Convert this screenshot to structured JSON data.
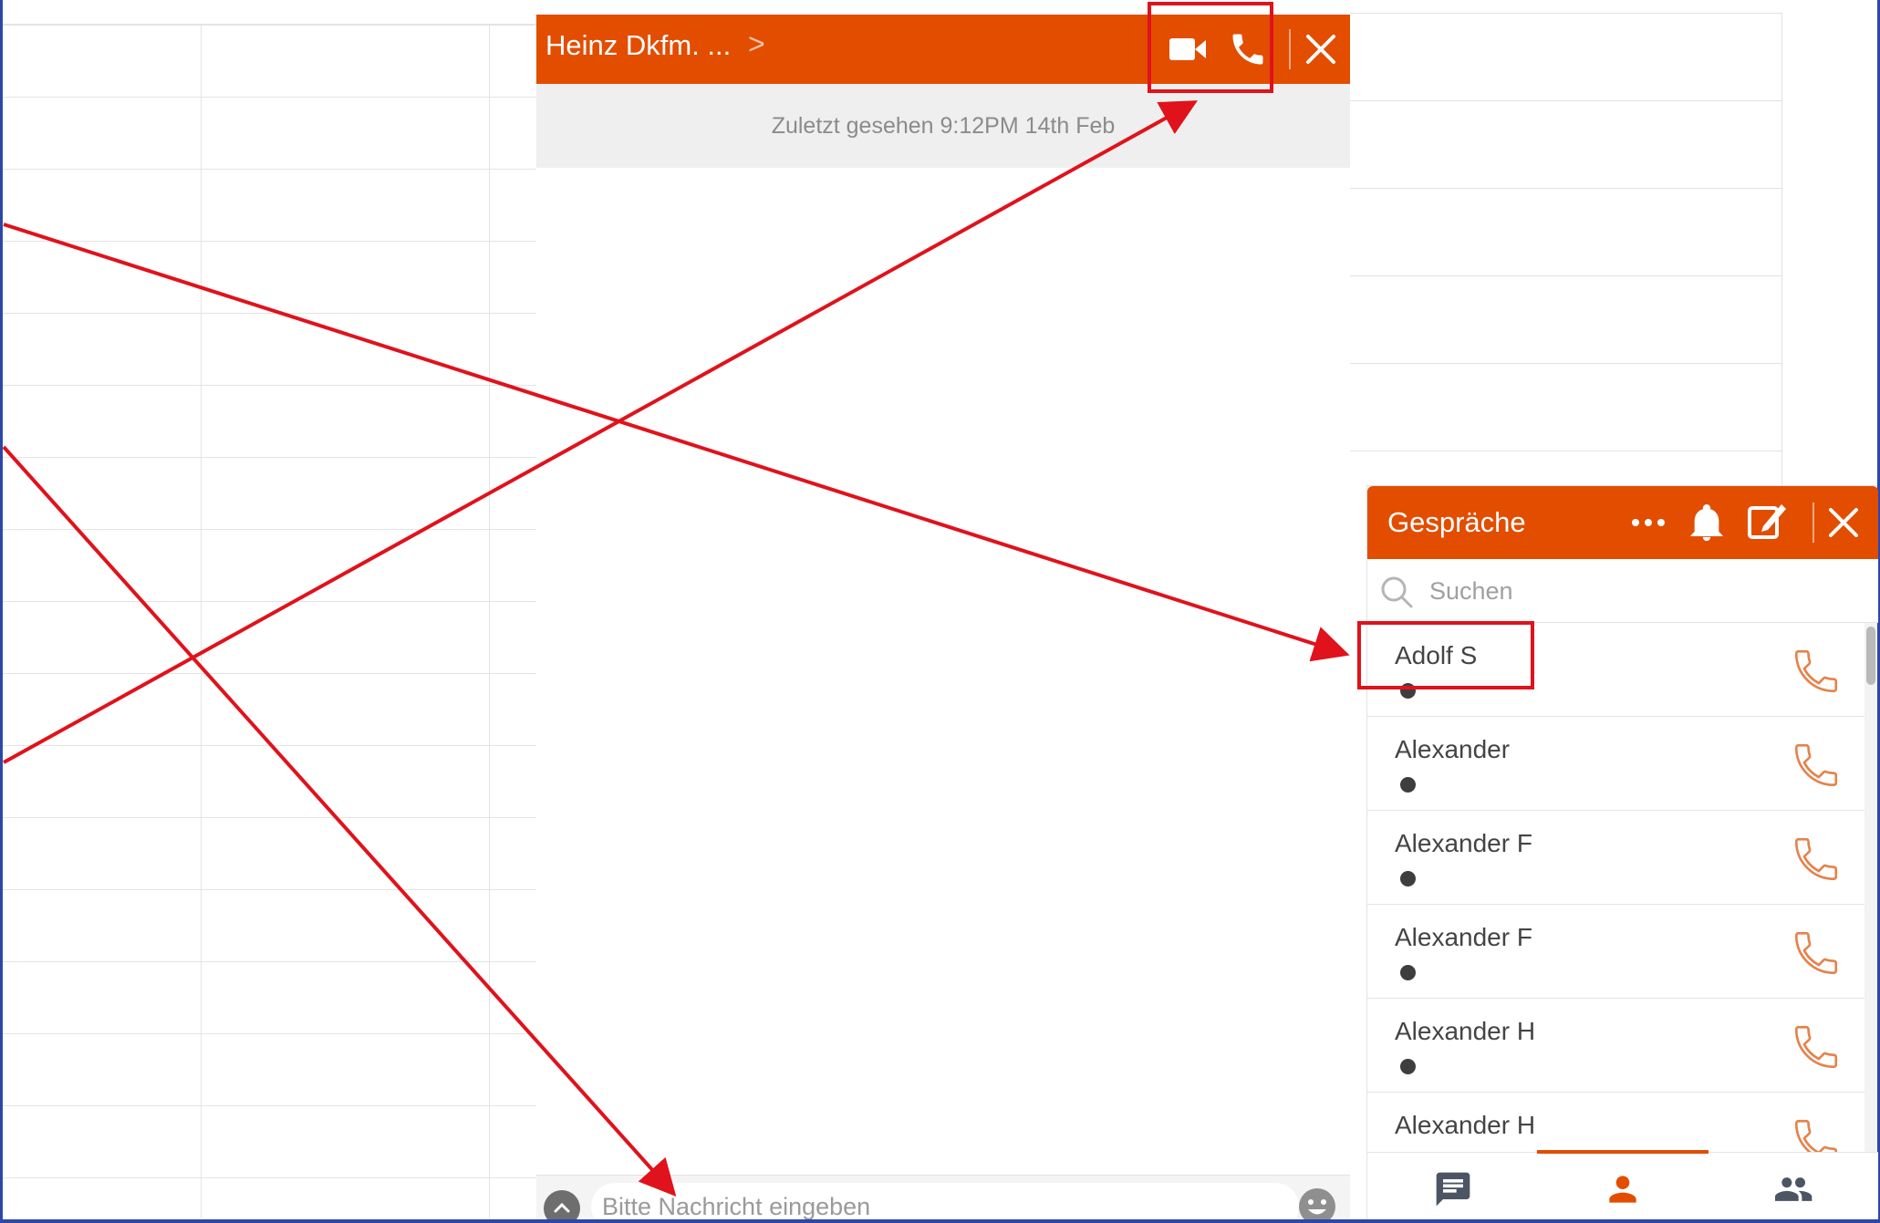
{
  "colors": {
    "accent": "#e24d00",
    "annotation": "#e0121b",
    "frame": "#2d47a8"
  },
  "chat": {
    "title": "Heinz Dkfm. ...",
    "chevron": ">",
    "last_seen": "Zuletzt gesehen 9:12PM 14th Feb",
    "input_placeholder": "Bitte Nachricht eingeben",
    "icons": [
      "video-camera-icon",
      "phone-icon",
      "close-icon",
      "chevron-up-icon",
      "emoji-icon"
    ]
  },
  "conversations": {
    "title": "Gespräche",
    "search_placeholder": "Suchen",
    "header_icons": [
      "more-icon",
      "bell-icon",
      "compose-icon",
      "close-icon"
    ],
    "contacts": [
      {
        "name": "Adolf S"
      },
      {
        "name": "Alexander"
      },
      {
        "name": "Alexander F"
      },
      {
        "name": "Alexander F"
      },
      {
        "name": "Alexander H"
      },
      {
        "name": "Alexander H"
      }
    ],
    "tabs": [
      {
        "icon": "chat-icon",
        "active": false
      },
      {
        "icon": "contact-icon",
        "active": true
      },
      {
        "icon": "group-icon",
        "active": false
      }
    ]
  }
}
